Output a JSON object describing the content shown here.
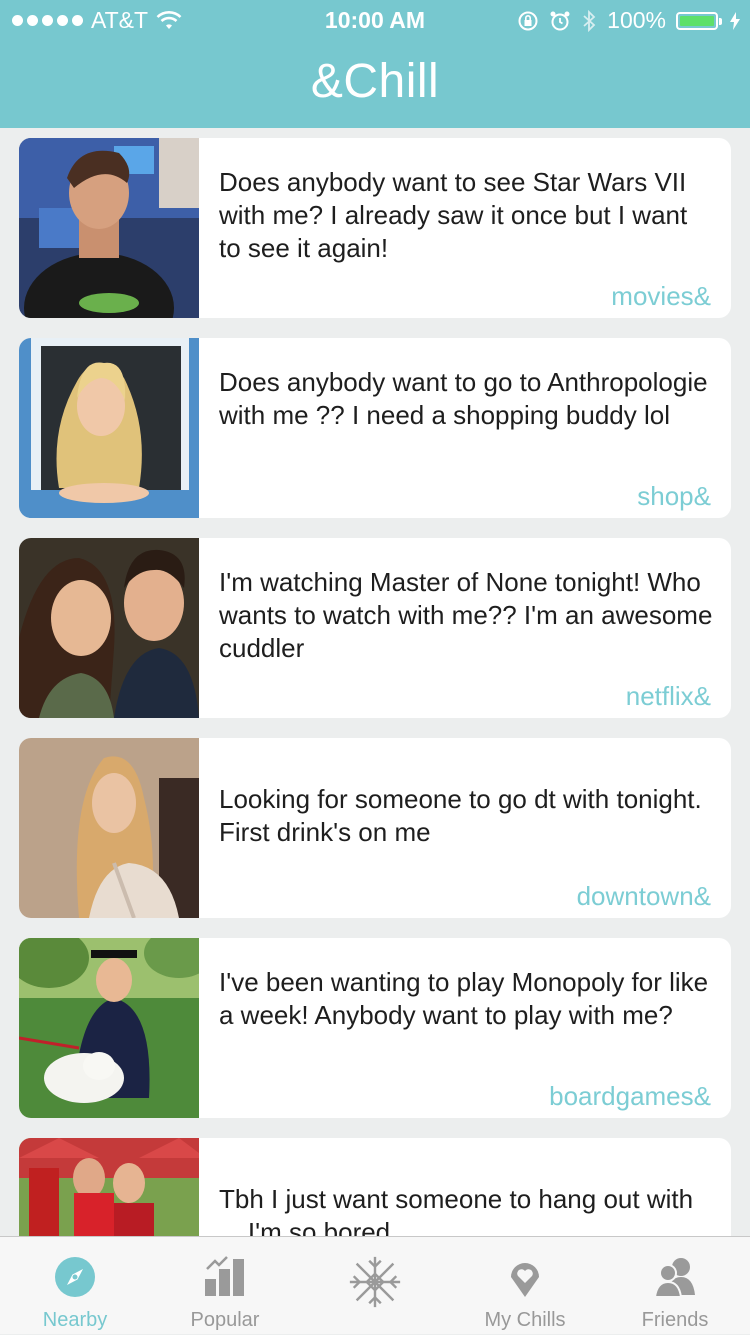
{
  "status_bar": {
    "carrier": "AT&T",
    "time": "10:00 AM",
    "battery": "100%"
  },
  "header": {
    "title": "&Chill"
  },
  "posts": [
    {
      "text": "Does anybody want to see Star Wars VII with me? I already saw it once but I want to see it again!",
      "tag": "movies&"
    },
    {
      "text": "Does anybody want to go to Anthropologie with me ?? I need a shopping buddy lol",
      "tag": "shop&"
    },
    {
      "text": "I'm watching Master of None tonight! Who wants to watch with me?? I'm an awesome cuddler",
      "tag": "netflix&"
    },
    {
      "text": "Looking for someone to go dt with tonight. First drink's on me",
      "tag": "downtown&"
    },
    {
      "text": "I've been wanting to play Monopoly for like a week! Anybody want to play with me?",
      "tag": "boardgames&"
    },
    {
      "text": "Tbh I just want someone to hang out with ... I'm so bored",
      "tag": ""
    }
  ],
  "tabs": [
    {
      "label": "Nearby",
      "icon": "compass-icon",
      "active": true
    },
    {
      "label": "Popular",
      "icon": "bar-chart-icon",
      "active": false
    },
    {
      "label": "",
      "icon": "snowflake-logo-icon",
      "active": false
    },
    {
      "label": "My Chills",
      "icon": "heart-pin-icon",
      "active": false
    },
    {
      "label": "Friends",
      "icon": "friends-icon",
      "active": false
    }
  ],
  "colors": {
    "accent": "#77c8cf",
    "tag": "#7ccdd4",
    "background": "#eceeee"
  }
}
